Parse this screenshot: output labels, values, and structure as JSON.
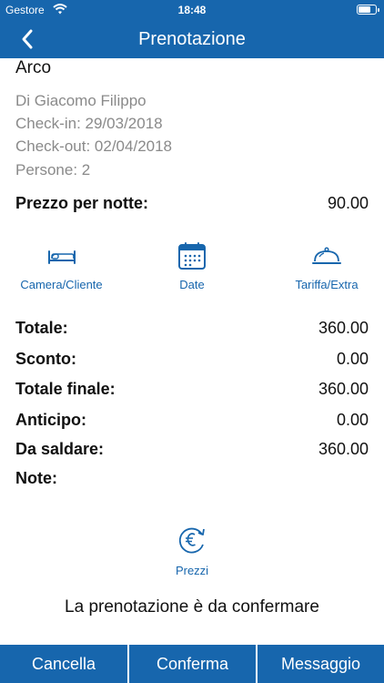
{
  "status": {
    "carrier": "Gestore",
    "time": "18:48",
    "battery_level": 0.7
  },
  "nav": {
    "title": "Prenotazione"
  },
  "room": "Arco",
  "guest": {
    "name": "Di Giacomo Filippo",
    "checkin": "Check-in: 29/03/2018",
    "checkout": "Check-out: 02/04/2018",
    "persons": "Persone: 2"
  },
  "price_per_night": {
    "label": "Prezzo per notte:",
    "value": "90.00"
  },
  "actions": [
    {
      "label": "Camera/Cliente",
      "icon": "bed-icon"
    },
    {
      "label": "Date",
      "icon": "calendar-icon"
    },
    {
      "label": "Tariffa/Extra",
      "icon": "cloche-icon"
    }
  ],
  "totals": [
    {
      "label": "Totale:",
      "value": "360.00"
    },
    {
      "label": "Sconto:",
      "value": "0.00"
    },
    {
      "label": "Totale finale:",
      "value": "360.00"
    },
    {
      "label": "Anticipo:",
      "value": "0.00"
    },
    {
      "label": "Da saldare:",
      "value": "360.00"
    }
  ],
  "notes_label": "Note:",
  "prices_button": {
    "label": "Prezzi",
    "icon": "euro-refresh-icon"
  },
  "confirm_message": "La prenotazione è da confermare",
  "bottom_buttons": [
    "Cancella",
    "Conferma",
    "Messaggio"
  ],
  "colors": {
    "primary": "#1766ad",
    "secondary_text": "#8a8a8a"
  }
}
